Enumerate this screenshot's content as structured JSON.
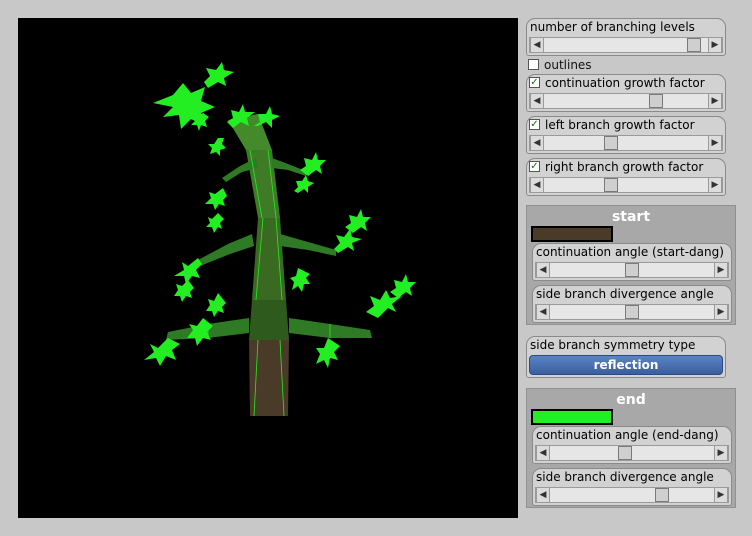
{
  "controls": {
    "levels": {
      "label": "number of branching levels",
      "value": 0.95
    },
    "outlines": {
      "label": "outlines",
      "checked": false
    },
    "continuation": {
      "label": "continuation growth factor",
      "checked": true,
      "value": 0.7
    },
    "left_branch": {
      "label": "left branch growth factor",
      "checked": true,
      "value": 0.4
    },
    "right_branch": {
      "label": "right branch growth factor",
      "checked": true,
      "value": 0.4
    }
  },
  "start_panel": {
    "title": "start",
    "color": "#4a3a28",
    "continuation": {
      "label": "continuation angle (start-dang)",
      "value": 0.5
    },
    "divergence": {
      "label": "side branch divergence angle",
      "value": 0.5
    }
  },
  "symmetry": {
    "label": "side branch symmetry type",
    "button": "reflection"
  },
  "end_panel": {
    "title": "end",
    "color": "#22ee22",
    "continuation": {
      "label": "continuation angle (end-dang)",
      "value": 0.45
    },
    "divergence": {
      "label": "side branch divergence angle",
      "value": 0.7
    }
  },
  "colors": {
    "trunk_dark": "#4a3a28",
    "mid_green": "#3a7a22",
    "leaf_green": "#22ee22"
  },
  "icons": {
    "left_arrow": "left-arrow-icon",
    "right_arrow": "right-arrow-icon",
    "check": "check-icon"
  }
}
